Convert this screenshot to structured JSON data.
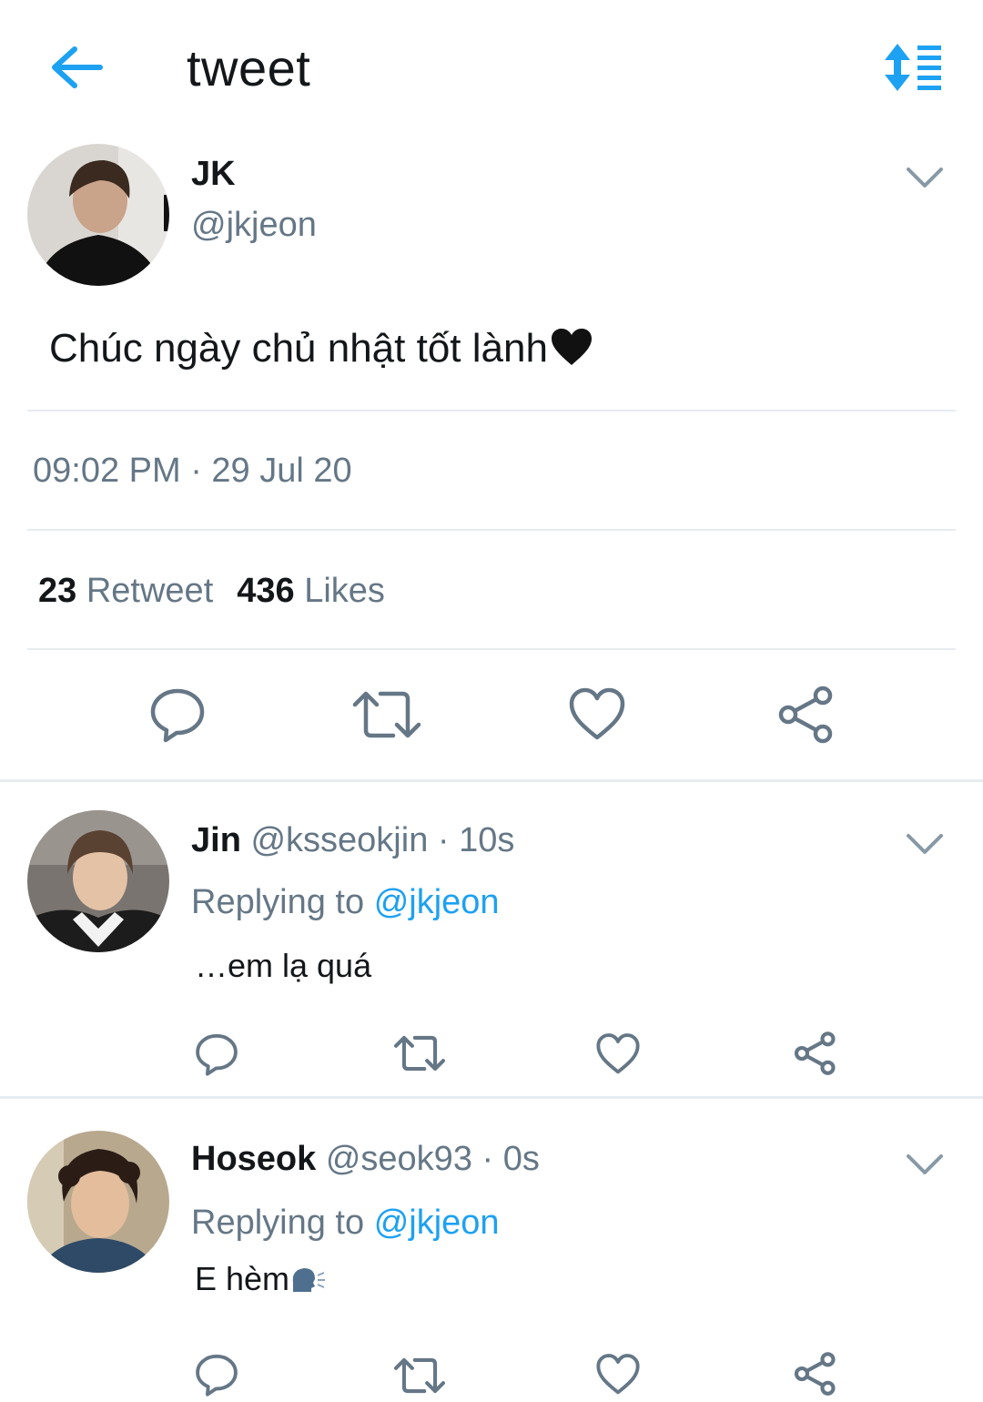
{
  "header": {
    "title": "tweet",
    "back_icon": "arrow-left-icon",
    "sort_icon": "sort-list-icon",
    "accent_color": "#1da1f2"
  },
  "main_tweet": {
    "author_name": "JK",
    "author_handle": "@jkjeon",
    "text": "Chúc ngày chủ nhật tốt lành",
    "emoji": "black-heart-emoji",
    "timestamp": "09:02 PM · 29 Jul 20",
    "retweet_count": "23",
    "retweet_label": "Retweet",
    "like_count": "436",
    "like_label": "Likes",
    "actions": [
      "reply-icon",
      "retweet-icon",
      "like-icon",
      "share-icon"
    ]
  },
  "replies": [
    {
      "name": "Jin",
      "handle": "@ksseokjin",
      "time": "· 10s",
      "replying_prefix": "Replying to",
      "replying_to": "@jkjeon",
      "text": "…em lạ quá",
      "emoji": ""
    },
    {
      "name": "Hoseok",
      "handle": "@seok93",
      "time": "· 0s",
      "replying_prefix": "Replying to",
      "replying_to": "@jkjeon",
      "text": "E hèm",
      "emoji": "speaking-head-emoji"
    }
  ],
  "colors": {
    "text_primary": "#14171a",
    "text_secondary": "#657786",
    "link": "#1da1f2",
    "divider": "#e6ecf0",
    "icon_gray": "#657786"
  }
}
